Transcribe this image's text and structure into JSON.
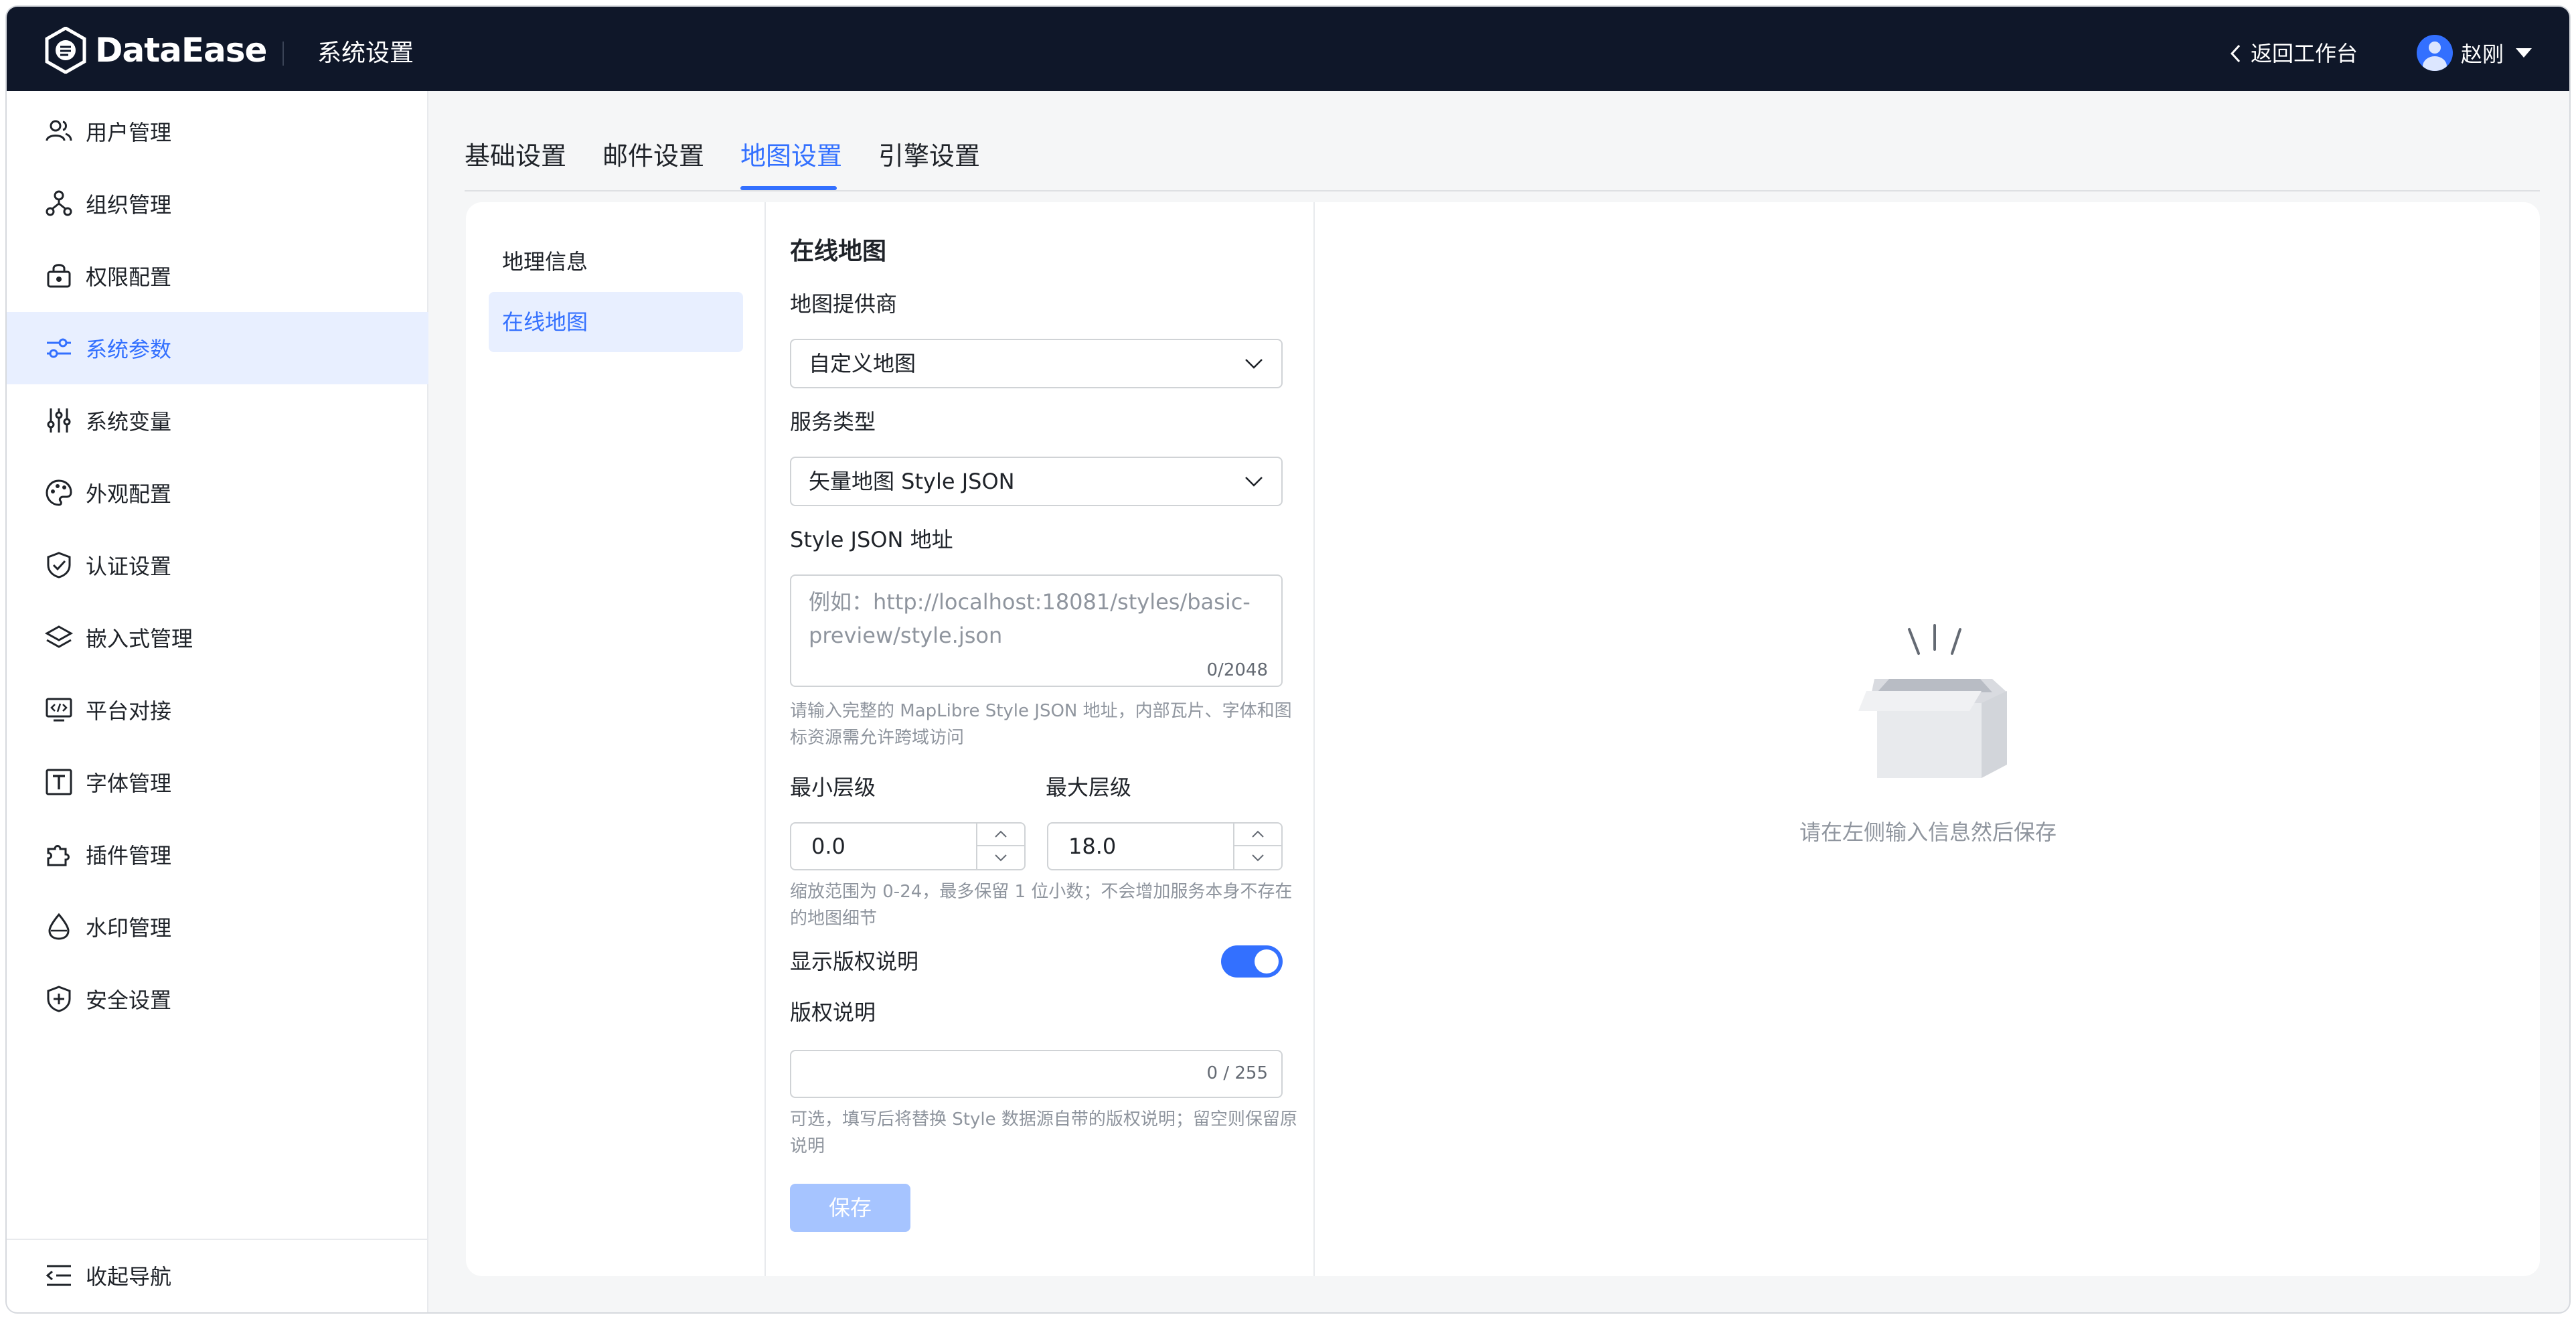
{
  "header": {
    "brand": "DataEase",
    "section_title": "系统设置",
    "back_label": "返回工作台",
    "user_name": "赵刚"
  },
  "sidebar": {
    "items": [
      {
        "label": "用户管理",
        "icon": "users-icon"
      },
      {
        "label": "组织管理",
        "icon": "org-icon"
      },
      {
        "label": "权限配置",
        "icon": "lock-icon"
      },
      {
        "label": "系统参数",
        "icon": "sliders-icon",
        "active": true
      },
      {
        "label": "系统变量",
        "icon": "variables-icon"
      },
      {
        "label": "外观配置",
        "icon": "palette-icon"
      },
      {
        "label": "认证设置",
        "icon": "shield-check-icon"
      },
      {
        "label": "嵌入式管理",
        "icon": "layers-icon"
      },
      {
        "label": "平台对接",
        "icon": "monitor-code-icon"
      },
      {
        "label": "字体管理",
        "icon": "font-icon"
      },
      {
        "label": "插件管理",
        "icon": "puzzle-icon"
      },
      {
        "label": "水印管理",
        "icon": "drop-icon"
      },
      {
        "label": "安全设置",
        "icon": "shield-plus-icon"
      }
    ],
    "collapse_label": "收起导航"
  },
  "tabs": [
    {
      "label": "基础设置"
    },
    {
      "label": "邮件设置"
    },
    {
      "label": "地图设置",
      "active": true
    },
    {
      "label": "引擎设置"
    }
  ],
  "sub_nav": [
    {
      "label": "地理信息"
    },
    {
      "label": "在线地图",
      "active": true
    }
  ],
  "form": {
    "title": "在线地图",
    "provider_label": "地图提供商",
    "provider_value": "自定义地图",
    "service_type_label": "服务类型",
    "service_type_value": "矢量地图 Style JSON",
    "style_url_label": "Style JSON 地址",
    "style_url_placeholder": "例如：http://localhost:18081/styles/basic-preview/style.json",
    "style_url_counter": "0/2048",
    "style_url_help": "请输入完整的 MapLibre Style JSON 地址，内部瓦片、字体和图标资源需允许跨域访问",
    "min_zoom_label": "最小层级",
    "min_zoom_value": "0.0",
    "max_zoom_label": "最大层级",
    "max_zoom_value": "18.0",
    "zoom_help": "缩放范围为 0-24，最多保留 1 位小数；不会增加服务本身不存在的地图细节",
    "show_copyright_label": "显示版权说明",
    "show_copyright_on": true,
    "copyright_label": "版权说明",
    "copyright_counter": "0 / 255",
    "copyright_help": "可选，填写后将替换 Style 数据源自带的版权说明；留空则保留原说明",
    "save_label": "保存"
  },
  "preview": {
    "empty_text": "请在左侧输入信息然后保存"
  },
  "colors": {
    "accent": "#3370ff",
    "topbar": "#0f1729"
  }
}
